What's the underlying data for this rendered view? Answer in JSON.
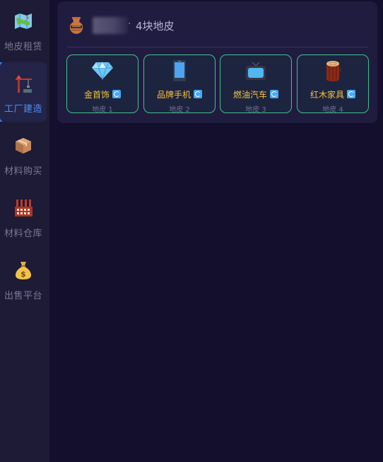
{
  "sidebar": {
    "items": [
      {
        "label": "地皮租赁",
        "icon": "map-icon",
        "active": false
      },
      {
        "label": "工厂建造",
        "icon": "crane-icon",
        "active": true
      },
      {
        "label": "材料购买",
        "icon": "package-icon",
        "active": false
      },
      {
        "label": "材料仓库",
        "icon": "factory-icon",
        "active": false
      },
      {
        "label": "出售平台",
        "icon": "money-bag-icon",
        "active": false
      }
    ],
    "active_color": "#4f8ff7"
  },
  "panel": {
    "header_icon": "amphora-icon",
    "separator": "·",
    "land_count_text": "4块地皮"
  },
  "cards": [
    {
      "name": "金首饰",
      "sub": "地皮 1",
      "icon": "diamond-icon"
    },
    {
      "name": "品牌手机",
      "sub": "地皮 2",
      "icon": "mobile-phone-icon"
    },
    {
      "name": "燃油汽车",
      "sub": "地皮 3",
      "icon": "tv-icon"
    },
    {
      "name": "红木家具",
      "sub": "地皮 4",
      "icon": "wood-log-icon"
    }
  ],
  "colors": {
    "background": "#130f2c",
    "sidebar": "#1d1b36",
    "panel": "#201c40",
    "card_border": "#3fc28d",
    "card_title": "#f2c23e",
    "refresh_icon": "#49a8f5"
  }
}
